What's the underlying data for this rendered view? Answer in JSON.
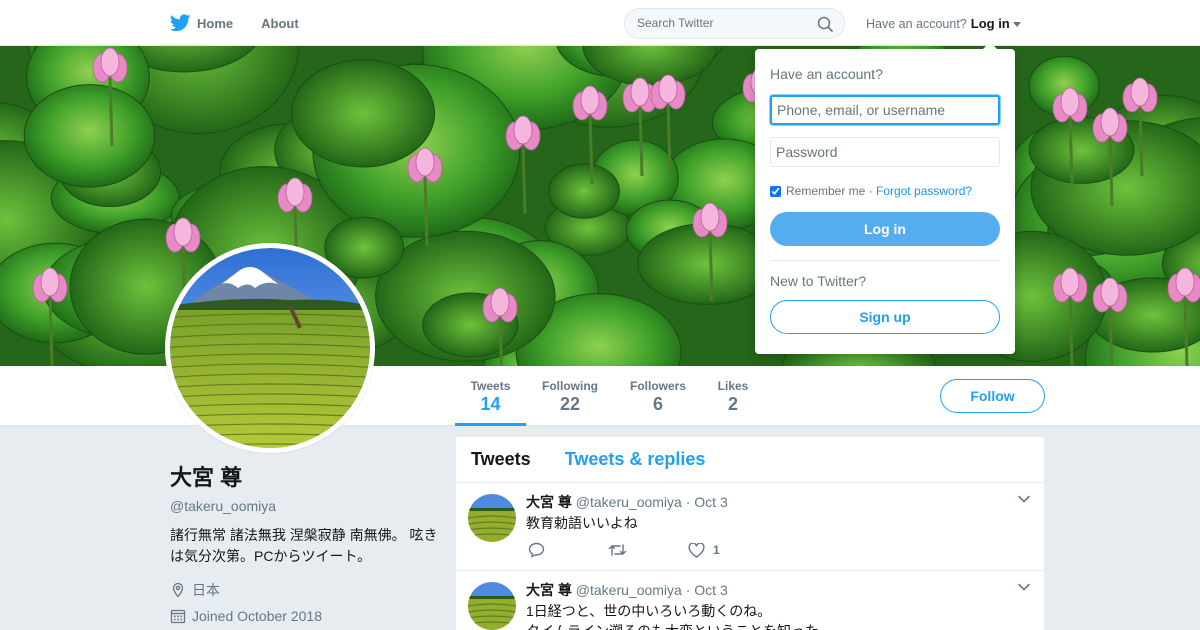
{
  "nav": {
    "home_label": "Home",
    "about_label": "About",
    "search_placeholder": "Search Twitter",
    "account_prompt": "Have an account?",
    "login_label": "Log in"
  },
  "profile": {
    "name": "大宮 尊",
    "handle": "@takeru_oomiya",
    "bio": "諸行無常 諸法無我 涅槃寂静 南無佛。 呟きは気分次第。PCからツイート。",
    "location": "日本",
    "joined": "Joined October 2018"
  },
  "stats": [
    {
      "label": "Tweets",
      "value": "14"
    },
    {
      "label": "Following",
      "value": "22"
    },
    {
      "label": "Followers",
      "value": "6"
    },
    {
      "label": "Likes",
      "value": "2"
    }
  ],
  "follow_label": "Follow",
  "timeline": {
    "tabs": [
      "Tweets",
      "Tweets & replies"
    ],
    "tweets": [
      {
        "name": "大宮 尊",
        "handle": "@takeru_oomiya",
        "separator": "·",
        "time": "Oct 3",
        "text": "教育勅語いいよね",
        "like_count": "1"
      },
      {
        "name": "大宮 尊",
        "handle": "@takeru_oomiya",
        "separator": "·",
        "time": "Oct 3",
        "text": "1日経つと、世の中いろいろ動くのね。",
        "text2": "タイムライン遡るのも大変ということを知った。"
      }
    ]
  },
  "login_dropdown": {
    "title": "Have an account?",
    "username_placeholder": "Phone, email, or username",
    "password_placeholder": "Password",
    "remember_label": "Remember me",
    "dot": " · ",
    "forgot_label": "Forgot password?",
    "login_button": "Log in",
    "new_prompt": "New to Twitter?",
    "signup_button": "Sign up"
  },
  "colors": {
    "brand": "#1da1f2",
    "login_button": "#55acee",
    "background": "#e6ecf0"
  }
}
